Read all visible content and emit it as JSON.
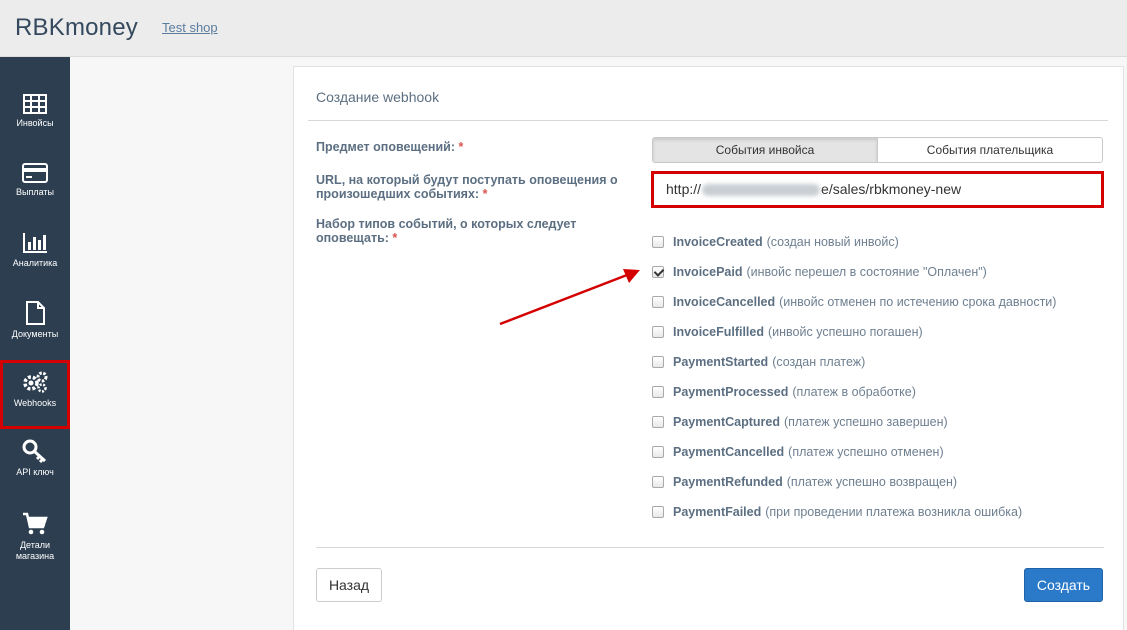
{
  "header": {
    "brand": "RBKmoney",
    "shop_link": "Test shop"
  },
  "sidebar": {
    "items": [
      {
        "label": "Инвойсы",
        "icon": "table-icon"
      },
      {
        "label": "Выплаты",
        "icon": "credit-card-icon"
      },
      {
        "label": "Аналитика",
        "icon": "bar-chart-icon"
      },
      {
        "label": "Документы",
        "icon": "document-icon"
      },
      {
        "label": "Webhooks",
        "icon": "gears-icon",
        "active": true
      },
      {
        "label": "API ключ",
        "icon": "key-icon"
      },
      {
        "label": "Детали магазина",
        "icon": "cart-icon"
      }
    ]
  },
  "form": {
    "title": "Создание webhook",
    "subject_label": "Предмет оповещений:",
    "url_label": "URL, на который будут поступать оповещения о произошедших событиях:",
    "events_label": "Набор типов событий, о которых следует оповещать:",
    "required_mark": "*",
    "subject_options": [
      "События инвойса",
      "События плательщика"
    ],
    "url_prefix": "http://",
    "url_suffix": "e/sales/rbkmoney-new",
    "events": [
      {
        "name": "InvoiceCreated",
        "desc": "(создан новый инвойс)",
        "checked": false
      },
      {
        "name": "InvoicePaid",
        "desc": "(инвойс перешел в состояние \"Оплачен\")",
        "checked": true
      },
      {
        "name": "InvoiceCancelled",
        "desc": "(инвойс отменен по истечению срока давности)",
        "checked": false
      },
      {
        "name": "InvoiceFulfilled",
        "desc": "(инвойс успешно погашен)",
        "checked": false
      },
      {
        "name": "PaymentStarted",
        "desc": "(создан платеж)",
        "checked": false
      },
      {
        "name": "PaymentProcessed",
        "desc": "(платеж в обработке)",
        "checked": false
      },
      {
        "name": "PaymentCaptured",
        "desc": "(платеж успешно завершен)",
        "checked": false
      },
      {
        "name": "PaymentCancelled",
        "desc": "(платеж успешно отменен)",
        "checked": false
      },
      {
        "name": "PaymentRefunded",
        "desc": "(платеж успешно возвращен)",
        "checked": false
      },
      {
        "name": "PaymentFailed",
        "desc": "(при проведении платежа возникла ошибка)",
        "checked": false
      }
    ],
    "back_label": "Назад",
    "create_label": "Создать"
  },
  "colors": {
    "sidebar_bg": "#2c3e50",
    "accent_blue": "#2a7ac9",
    "highlight_red": "#d40000"
  }
}
